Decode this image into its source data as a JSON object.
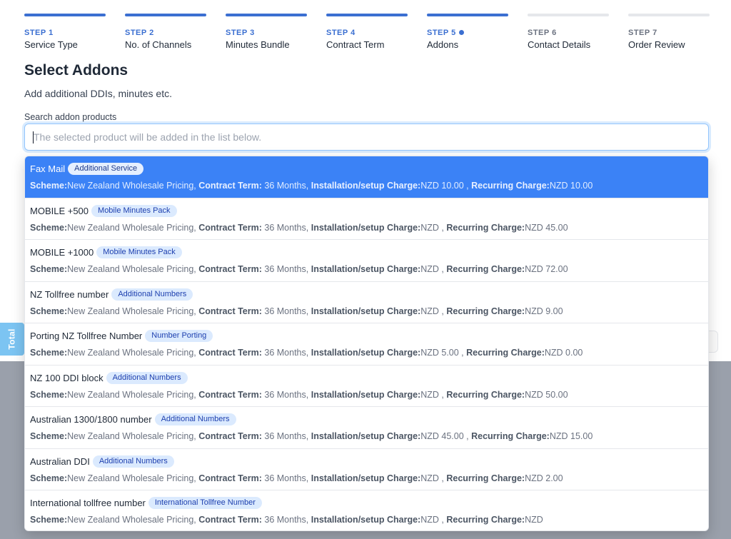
{
  "steps": [
    {
      "num": "STEP 1",
      "name": "Service Type",
      "state": "done"
    },
    {
      "num": "STEP 2",
      "name": "No. of Channels",
      "state": "done"
    },
    {
      "num": "STEP 3",
      "name": "Minutes Bundle",
      "state": "done"
    },
    {
      "num": "STEP 4",
      "name": "Contract Term",
      "state": "done"
    },
    {
      "num": "STEP 5",
      "name": "Addons",
      "state": "current"
    },
    {
      "num": "STEP 6",
      "name": "Contact Details",
      "state": "todo"
    },
    {
      "num": "STEP 7",
      "name": "Order Review",
      "state": "todo"
    }
  ],
  "page": {
    "title": "Select Addons",
    "subtitle": "Add additional DDIs, minutes etc."
  },
  "search": {
    "label": "Search addon products",
    "placeholder": "The selected product will be added in the list below.",
    "value": ""
  },
  "total_tab": "Total",
  "labels": {
    "scheme": "Scheme:",
    "contract_term": "Contract Term:",
    "setup": "Installation/setup Charge:",
    "recurring": "Recurring Charge:"
  },
  "options": [
    {
      "name": "Fax Mail",
      "badge": "Additional Service",
      "scheme": "New Zealand Wholesale Pricing,",
      "term": "36 Months,",
      "setup": "NZD 10.00 ,",
      "recurring": "NZD 10.00",
      "active": true
    },
    {
      "name": "MOBILE +500",
      "badge": "Mobile Minutes Pack",
      "scheme": "New Zealand Wholesale Pricing,",
      "term": "36 Months,",
      "setup": "NZD ,",
      "recurring": "NZD 45.00",
      "active": false
    },
    {
      "name": "MOBILE +1000",
      "badge": "Mobile Minutes Pack",
      "scheme": "New Zealand Wholesale Pricing,",
      "term": "36 Months,",
      "setup": "NZD ,",
      "recurring": "NZD 72.00",
      "active": false
    },
    {
      "name": "NZ Tollfree number",
      "badge": "Additional Numbers",
      "scheme": "New Zealand Wholesale Pricing,",
      "term": "36 Months,",
      "setup": "NZD ,",
      "recurring": "NZD 9.00",
      "active": false
    },
    {
      "name": "Porting NZ Tollfree Number",
      "badge": "Number Porting",
      "scheme": "New Zealand Wholesale Pricing,",
      "term": "36 Months,",
      "setup": "NZD 5.00 ,",
      "recurring": "NZD 0.00",
      "active": false
    },
    {
      "name": "NZ 100 DDI block",
      "badge": "Additional Numbers",
      "scheme": "New Zealand Wholesale Pricing,",
      "term": "36 Months,",
      "setup": "NZD ,",
      "recurring": "NZD 50.00",
      "active": false
    },
    {
      "name": "Australian 1300/1800 number",
      "badge": "Additional Numbers",
      "scheme": "New Zealand Wholesale Pricing,",
      "term": "36 Months,",
      "setup": "NZD 45.00 ,",
      "recurring": "NZD 15.00",
      "active": false
    },
    {
      "name": "Australian DDI",
      "badge": "Additional Numbers",
      "scheme": "New Zealand Wholesale Pricing,",
      "term": "36 Months,",
      "setup": "NZD ,",
      "recurring": "NZD 2.00",
      "active": false
    },
    {
      "name": "International tollfree number",
      "badge": "International Tollfree Number",
      "scheme": "New Zealand Wholesale Pricing,",
      "term": "36 Months,",
      "setup": "NZD ,",
      "recurring": "NZD",
      "active": false
    }
  ],
  "colors": {
    "accent": "#3b6fd1",
    "active_row": "#3b82f6",
    "badge_bg": "#dbeafe",
    "total_tab": "#7cc4f2"
  }
}
